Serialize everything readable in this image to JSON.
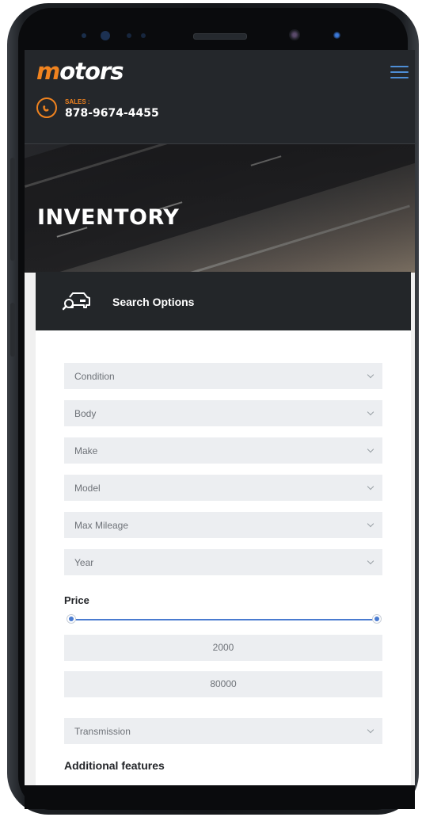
{
  "header": {
    "logo_accent": "m",
    "logo_rest": "otors",
    "sales_label": "SALES :",
    "sales_number": "878-9674-4455"
  },
  "hero": {
    "title": "INVENTORY"
  },
  "search": {
    "title": "Search Options",
    "filters": [
      "Condition",
      "Body",
      "Make",
      "Model",
      "Max Mileage",
      "Year"
    ],
    "price_label": "Price",
    "price_min": "2000",
    "price_max": "80000",
    "transmission": "Transmission",
    "additional_features": "Additional features"
  },
  "colors": {
    "accent": "#f0831f",
    "header_bg": "#24272b",
    "slider": "#4a7bd0",
    "field_bg": "#eceef1"
  },
  "icons": [
    "hamburger-menu-icon",
    "phone-icon",
    "car-search-icon",
    "chevron-down-icon"
  ]
}
